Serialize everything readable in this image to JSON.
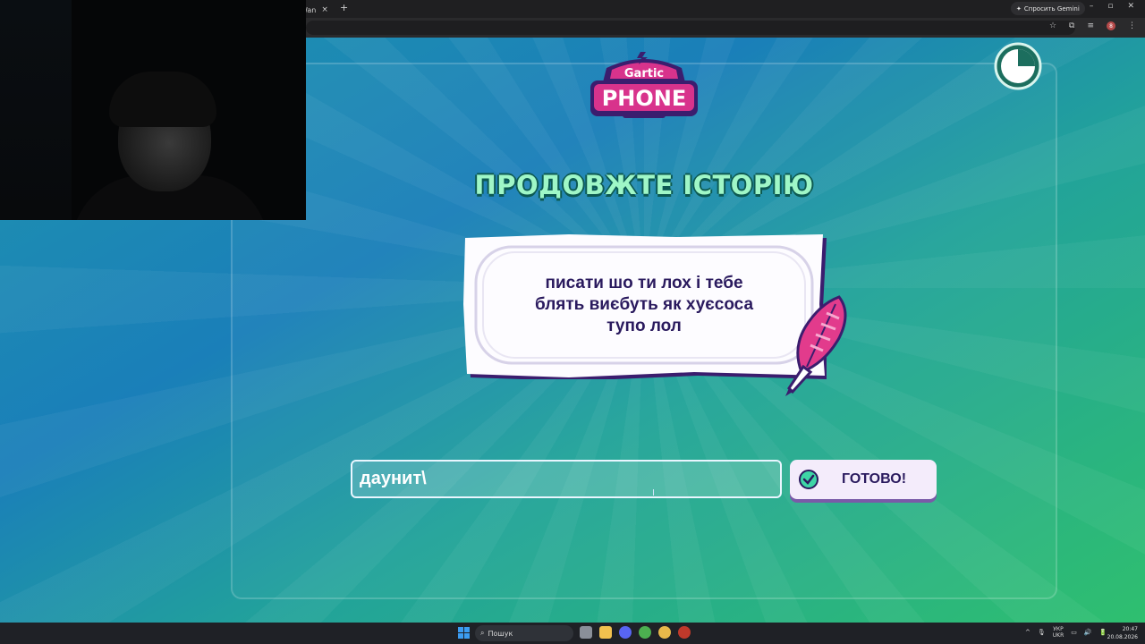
{
  "browser": {
    "tab_label": "Wan",
    "tab_close": "×",
    "new_tab": "+",
    "gemini_label": "Спросить Gemini",
    "window_controls": [
      "–",
      "▫",
      "✕"
    ],
    "toolbar_icons": [
      "☆",
      "⧉",
      "≡",
      "⋮"
    ],
    "profile_badge": "8"
  },
  "game": {
    "logo_top": "Gartic",
    "logo_bottom": "PHONE",
    "prompt_title": "ПРОДОВЖТЕ ІСТОРІЮ",
    "story_text_line1": "писати шо ти лох і тебе",
    "story_text_line2": "блять виєбуть як хуєсоса",
    "story_text_line3": "тупо лол",
    "answer_value": "даунит\\",
    "cursor_glyph": "I",
    "done_button_label": "ГОТОВО!",
    "timer_fraction_remaining": 0.75
  },
  "taskbar": {
    "search_label": "Пошук",
    "lang_top": "УКР",
    "lang_bottom": "UKR",
    "tray_icons": [
      "^",
      "🎙",
      "▭",
      "🔊",
      "🔋"
    ],
    "time": "20:47",
    "date": "20.08.2026"
  },
  "colors": {
    "title_color": "#9ff7c7",
    "story_color": "#2a1a5e",
    "accent_purple": "#3b1d6e",
    "logo_pink": "#d8338c"
  }
}
